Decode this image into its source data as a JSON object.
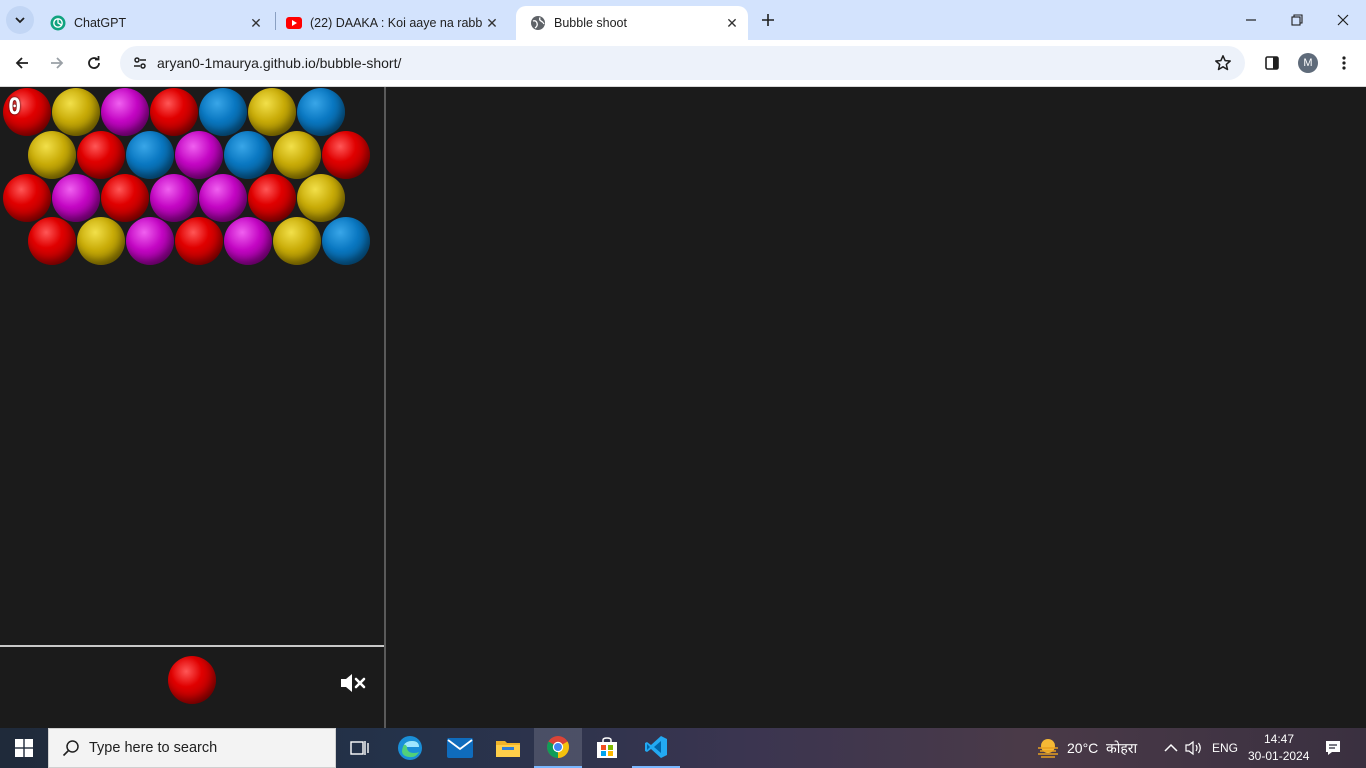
{
  "browser": {
    "tabs": [
      {
        "title": "ChatGPT",
        "icon": "chatgpt-icon",
        "active": false
      },
      {
        "title": "(22) DAAKA : Koi aaye na rabba",
        "icon": "youtube-icon",
        "active": false
      },
      {
        "title": "Bubble shoot",
        "icon": "globe-icon",
        "active": true
      }
    ],
    "url": "aryan0-1maurya.github.io/bubble-short/",
    "profile_initial": "M"
  },
  "game": {
    "score": "0",
    "colors": {
      "red": "#e00000",
      "yellow": "#c9ac08",
      "magenta": "#c406c4",
      "blue": "#0a78c2"
    },
    "grid": [
      [
        "red",
        "yellow",
        "magenta",
        "red",
        "blue",
        "yellow",
        "blue"
      ],
      [
        "yellow",
        "red",
        "blue",
        "magenta",
        "blue",
        "yellow",
        "red"
      ],
      [
        "red",
        "magenta",
        "red",
        "magenta",
        "magenta",
        "red",
        "yellow"
      ],
      [
        "red",
        "yellow",
        "magenta",
        "red",
        "magenta",
        "yellow",
        "blue"
      ]
    ],
    "shooter_color": "red",
    "sound": "muted"
  },
  "taskbar": {
    "search_placeholder": "Type here to search",
    "apps": [
      "task-view-icon",
      "edge-icon",
      "mail-icon",
      "file-explorer-icon",
      "chrome-icon",
      "store-icon",
      "vscode-icon"
    ],
    "weather_temp": "20°C",
    "weather_desc": "कोहरा",
    "language": "ENG",
    "time": "14:47",
    "date": "30-01-2024"
  }
}
